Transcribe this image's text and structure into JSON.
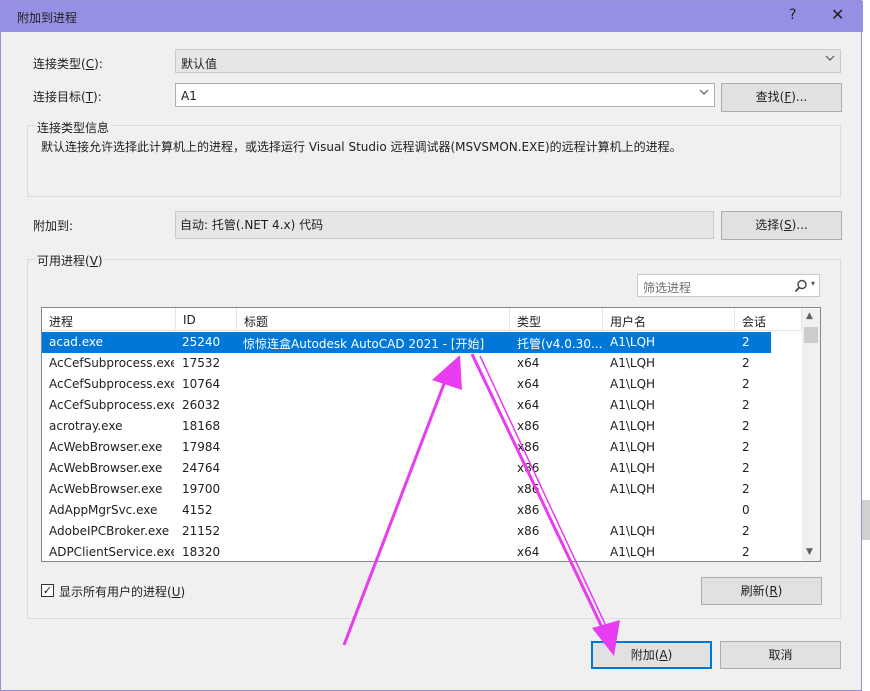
{
  "window": {
    "title": "附加到进程",
    "help": "?",
    "close": "✕"
  },
  "connection_type": {
    "label": "连接类型(C):",
    "value": "默认值"
  },
  "connection_target": {
    "label": "连接目标(T):",
    "value": "A1",
    "find_button": "查找(F)..."
  },
  "connection_info": {
    "group_label": "连接类型信息",
    "text": "默认连接允许选择此计算机上的进程，或选择运行 Visual Studio 远程调试器(MSVSMON.EXE)的远程计算机上的进程。"
  },
  "attach_to": {
    "label": "附加到:",
    "value": "自动: 托管(.NET 4.x) 代码",
    "select_button": "选择(S)..."
  },
  "processes": {
    "group_label": "可用进程(V)",
    "filter_placeholder": "筛选进程",
    "columns": [
      "进程",
      "ID",
      "标题",
      "类型",
      "用户名",
      "会话"
    ],
    "rows": [
      {
        "name": "acad.exe",
        "id": "25240",
        "title": "惊惊连盒Autodesk AutoCAD 2021 - [开始]",
        "type": "托管(v4.0.30...",
        "user": "A1\\LQH",
        "session": "2",
        "selected": true
      },
      {
        "name": "AcCefSubprocess.exe",
        "id": "17532",
        "title": "",
        "type": "x64",
        "user": "A1\\LQH",
        "session": "2"
      },
      {
        "name": "AcCefSubprocess.exe",
        "id": "10764",
        "title": "",
        "type": "x64",
        "user": "A1\\LQH",
        "session": "2"
      },
      {
        "name": "AcCefSubprocess.exe",
        "id": "26032",
        "title": "",
        "type": "x64",
        "user": "A1\\LQH",
        "session": "2"
      },
      {
        "name": "acrotray.exe",
        "id": "18168",
        "title": "",
        "type": "x86",
        "user": "A1\\LQH",
        "session": "2"
      },
      {
        "name": "AcWebBrowser.exe",
        "id": "17984",
        "title": "",
        "type": "x86",
        "user": "A1\\LQH",
        "session": "2"
      },
      {
        "name": "AcWebBrowser.exe",
        "id": "24764",
        "title": "",
        "type": "x86",
        "user": "A1\\LQH",
        "session": "2"
      },
      {
        "name": "AcWebBrowser.exe",
        "id": "19700",
        "title": "",
        "type": "x86",
        "user": "A1\\LQH",
        "session": "2"
      },
      {
        "name": "AdAppMgrSvc.exe",
        "id": "4152",
        "title": "",
        "type": "x86",
        "user": "",
        "session": "0"
      },
      {
        "name": "AdobeIPCBroker.exe",
        "id": "21152",
        "title": "",
        "type": "x86",
        "user": "A1\\LQH",
        "session": "2"
      },
      {
        "name": "ADPClientService.exe",
        "id": "18320",
        "title": "",
        "type": "x64",
        "user": "A1\\LQH",
        "session": "2"
      }
    ],
    "show_all_users": {
      "label": "显示所有用户的进程(U)",
      "checked": true
    },
    "refresh_button": "刷新(R)"
  },
  "footer": {
    "attach_button": "附加(A)",
    "cancel_button": "取消"
  },
  "annotation": {
    "arrow_color": "#e83cf0"
  },
  "icons": {
    "dropdown": "chevron-down-icon",
    "search": "search-icon",
    "check": "checkmark-icon"
  }
}
